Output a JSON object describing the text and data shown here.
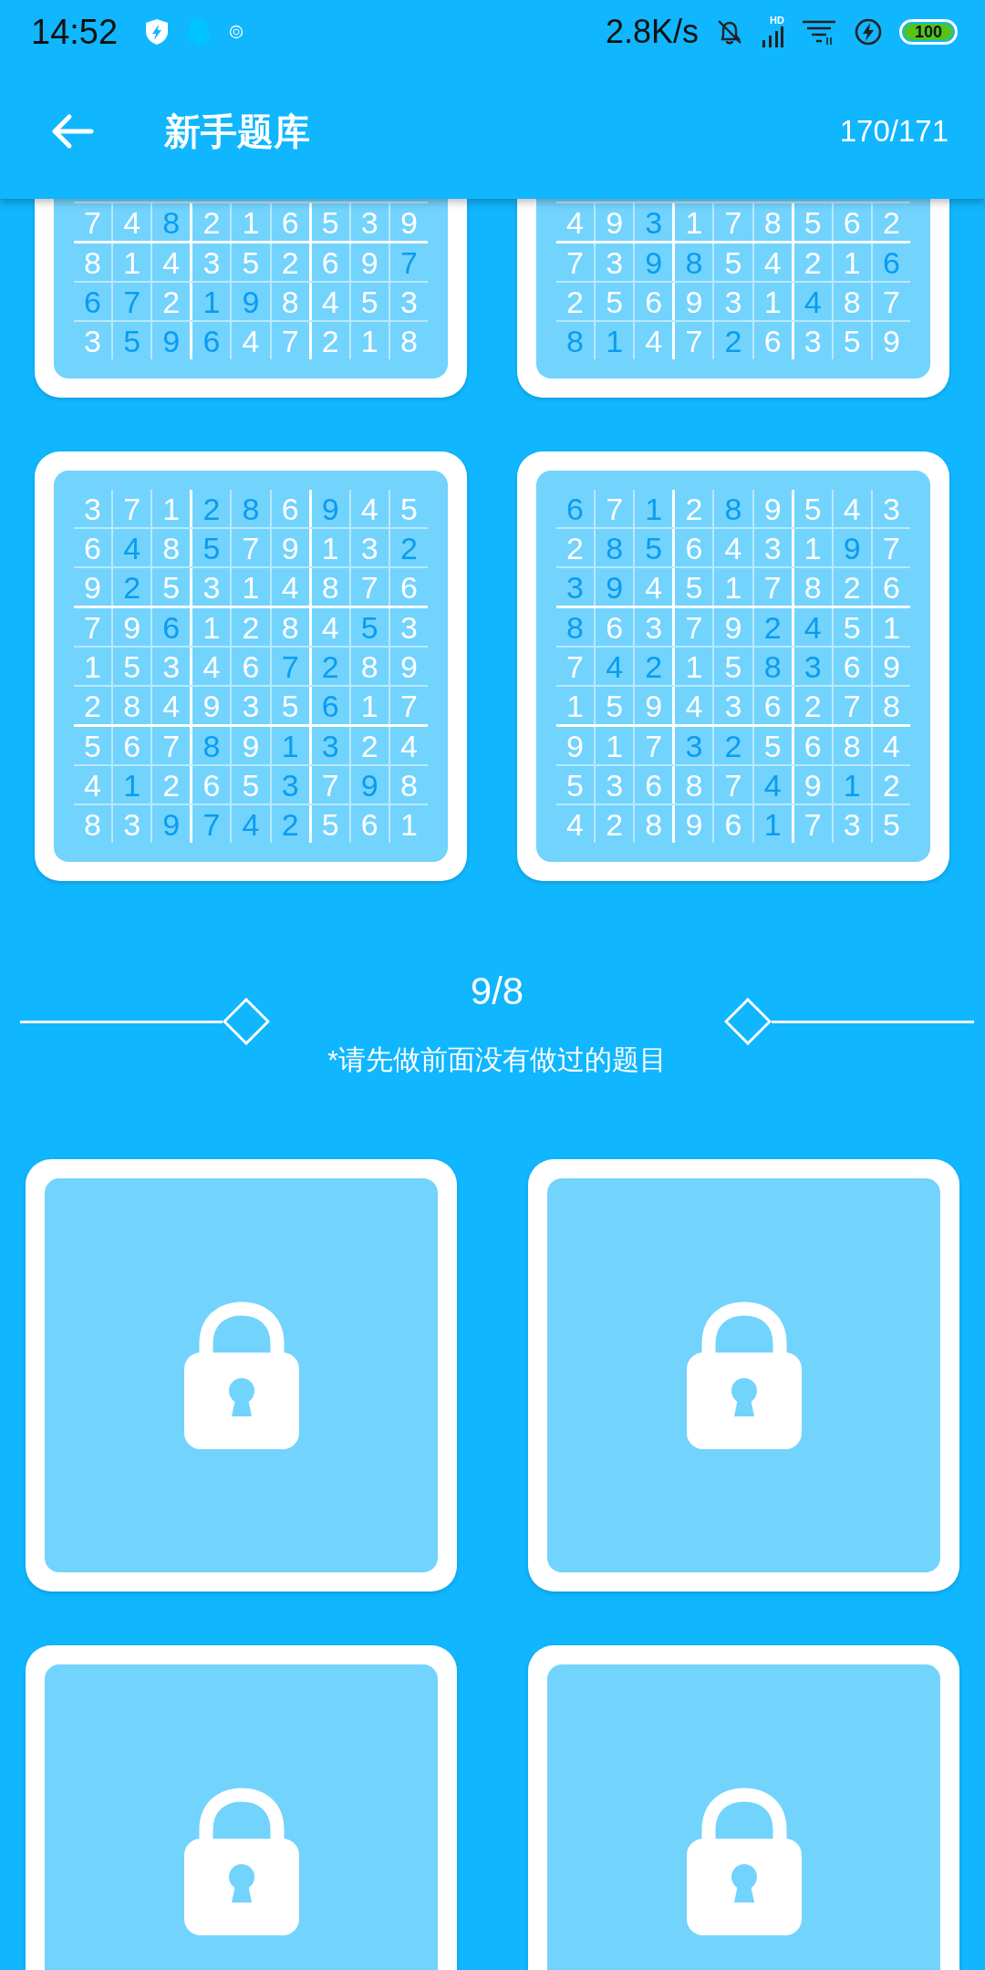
{
  "status_bar": {
    "time": "14:52",
    "network_speed": "2.8K/s",
    "signal_label": "HD",
    "battery": "100"
  },
  "toolbar": {
    "title": "新手题库",
    "progress": "170/171"
  },
  "solved_puzzles": [
    {
      "rows": [
        {
          "digits": [
            "7",
            "4",
            "8",
            "2",
            "1",
            "6",
            "5",
            "3",
            "9"
          ],
          "given": [
            false,
            false,
            true,
            false,
            false,
            false,
            false,
            false,
            false
          ]
        },
        {
          "digits": [
            "8",
            "1",
            "4",
            "3",
            "5",
            "2",
            "6",
            "9",
            "7"
          ],
          "given": [
            false,
            false,
            false,
            false,
            false,
            false,
            false,
            false,
            true
          ]
        },
        {
          "digits": [
            "6",
            "7",
            "2",
            "1",
            "9",
            "8",
            "4",
            "5",
            "3"
          ],
          "given": [
            true,
            true,
            false,
            true,
            true,
            false,
            false,
            false,
            false
          ]
        },
        {
          "digits": [
            "3",
            "5",
            "9",
            "6",
            "4",
            "7",
            "2",
            "1",
            "8"
          ],
          "given": [
            false,
            true,
            true,
            true,
            false,
            false,
            false,
            false,
            false
          ]
        }
      ]
    },
    {
      "rows": [
        {
          "digits": [
            "4",
            "9",
            "3",
            "1",
            "7",
            "8",
            "5",
            "6",
            "2"
          ],
          "given": [
            false,
            false,
            true,
            false,
            false,
            false,
            false,
            false,
            false
          ]
        },
        {
          "digits": [
            "7",
            "3",
            "9",
            "8",
            "5",
            "4",
            "2",
            "1",
            "6"
          ],
          "given": [
            false,
            false,
            true,
            true,
            false,
            false,
            false,
            false,
            true
          ]
        },
        {
          "digits": [
            "2",
            "5",
            "6",
            "9",
            "3",
            "1",
            "4",
            "8",
            "7"
          ],
          "given": [
            false,
            false,
            false,
            false,
            false,
            false,
            true,
            false,
            false
          ]
        },
        {
          "digits": [
            "8",
            "1",
            "4",
            "7",
            "2",
            "6",
            "3",
            "5",
            "9"
          ],
          "given": [
            true,
            true,
            false,
            false,
            true,
            false,
            false,
            false,
            false
          ]
        }
      ]
    },
    {
      "rows": [
        {
          "digits": [
            "3",
            "7",
            "1",
            "2",
            "8",
            "6",
            "9",
            "4",
            "5"
          ],
          "given": [
            false,
            false,
            false,
            true,
            true,
            false,
            true,
            false,
            false
          ]
        },
        {
          "digits": [
            "6",
            "4",
            "8",
            "5",
            "7",
            "9",
            "1",
            "3",
            "2"
          ],
          "given": [
            false,
            true,
            false,
            true,
            false,
            false,
            false,
            false,
            true
          ]
        },
        {
          "digits": [
            "9",
            "2",
            "5",
            "3",
            "1",
            "4",
            "8",
            "7",
            "6"
          ],
          "given": [
            false,
            true,
            false,
            false,
            false,
            false,
            false,
            false,
            false
          ]
        },
        {
          "digits": [
            "7",
            "9",
            "6",
            "1",
            "2",
            "8",
            "4",
            "5",
            "3"
          ],
          "given": [
            false,
            false,
            true,
            false,
            false,
            false,
            false,
            true,
            false
          ]
        },
        {
          "digits": [
            "1",
            "5",
            "3",
            "4",
            "6",
            "7",
            "2",
            "8",
            "9"
          ],
          "given": [
            false,
            false,
            false,
            false,
            false,
            true,
            true,
            false,
            false
          ]
        },
        {
          "digits": [
            "2",
            "8",
            "4",
            "9",
            "3",
            "5",
            "6",
            "1",
            "7"
          ],
          "given": [
            false,
            false,
            false,
            false,
            false,
            false,
            true,
            false,
            false
          ]
        },
        {
          "digits": [
            "5",
            "6",
            "7",
            "8",
            "9",
            "1",
            "3",
            "2",
            "4"
          ],
          "given": [
            false,
            false,
            false,
            true,
            false,
            true,
            true,
            false,
            false
          ]
        },
        {
          "digits": [
            "4",
            "1",
            "2",
            "6",
            "5",
            "3",
            "7",
            "9",
            "8"
          ],
          "given": [
            false,
            true,
            false,
            false,
            false,
            true,
            false,
            true,
            false
          ]
        },
        {
          "digits": [
            "8",
            "3",
            "9",
            "7",
            "4",
            "2",
            "5",
            "6",
            "1"
          ],
          "given": [
            false,
            false,
            true,
            true,
            true,
            true,
            false,
            false,
            false
          ]
        }
      ]
    },
    {
      "rows": [
        {
          "digits": [
            "6",
            "7",
            "1",
            "2",
            "8",
            "9",
            "5",
            "4",
            "3"
          ],
          "given": [
            true,
            false,
            true,
            false,
            true,
            false,
            false,
            false,
            false
          ]
        },
        {
          "digits": [
            "2",
            "8",
            "5",
            "6",
            "4",
            "3",
            "1",
            "9",
            "7"
          ],
          "given": [
            false,
            true,
            true,
            false,
            false,
            false,
            false,
            true,
            false
          ]
        },
        {
          "digits": [
            "3",
            "9",
            "4",
            "5",
            "1",
            "7",
            "8",
            "2",
            "6"
          ],
          "given": [
            true,
            true,
            false,
            false,
            false,
            false,
            false,
            false,
            false
          ]
        },
        {
          "digits": [
            "8",
            "6",
            "3",
            "7",
            "9",
            "2",
            "4",
            "5",
            "1"
          ],
          "given": [
            true,
            false,
            false,
            false,
            false,
            true,
            true,
            false,
            false
          ]
        },
        {
          "digits": [
            "7",
            "4",
            "2",
            "1",
            "5",
            "8",
            "3",
            "6",
            "9"
          ],
          "given": [
            false,
            true,
            true,
            false,
            false,
            true,
            true,
            false,
            false
          ]
        },
        {
          "digits": [
            "1",
            "5",
            "9",
            "4",
            "3",
            "6",
            "2",
            "7",
            "8"
          ],
          "given": [
            false,
            false,
            false,
            false,
            false,
            false,
            false,
            false,
            false
          ]
        },
        {
          "digits": [
            "9",
            "1",
            "7",
            "3",
            "2",
            "5",
            "6",
            "8",
            "4"
          ],
          "given": [
            false,
            false,
            false,
            true,
            true,
            false,
            false,
            false,
            false
          ]
        },
        {
          "digits": [
            "5",
            "3",
            "6",
            "8",
            "7",
            "4",
            "9",
            "1",
            "2"
          ],
          "given": [
            false,
            false,
            false,
            false,
            false,
            true,
            false,
            true,
            false
          ]
        },
        {
          "digits": [
            "4",
            "2",
            "8",
            "9",
            "6",
            "1",
            "7",
            "3",
            "5"
          ],
          "given": [
            false,
            false,
            false,
            false,
            false,
            true,
            false,
            false,
            false
          ]
        }
      ]
    }
  ],
  "locked_section": {
    "count": "9/8",
    "hint": "*请先做前面没有做过的题目"
  },
  "locked_puzzles": [
    {
      "locked": true
    },
    {
      "locked": true
    },
    {
      "locked": true
    },
    {
      "locked": true
    }
  ]
}
